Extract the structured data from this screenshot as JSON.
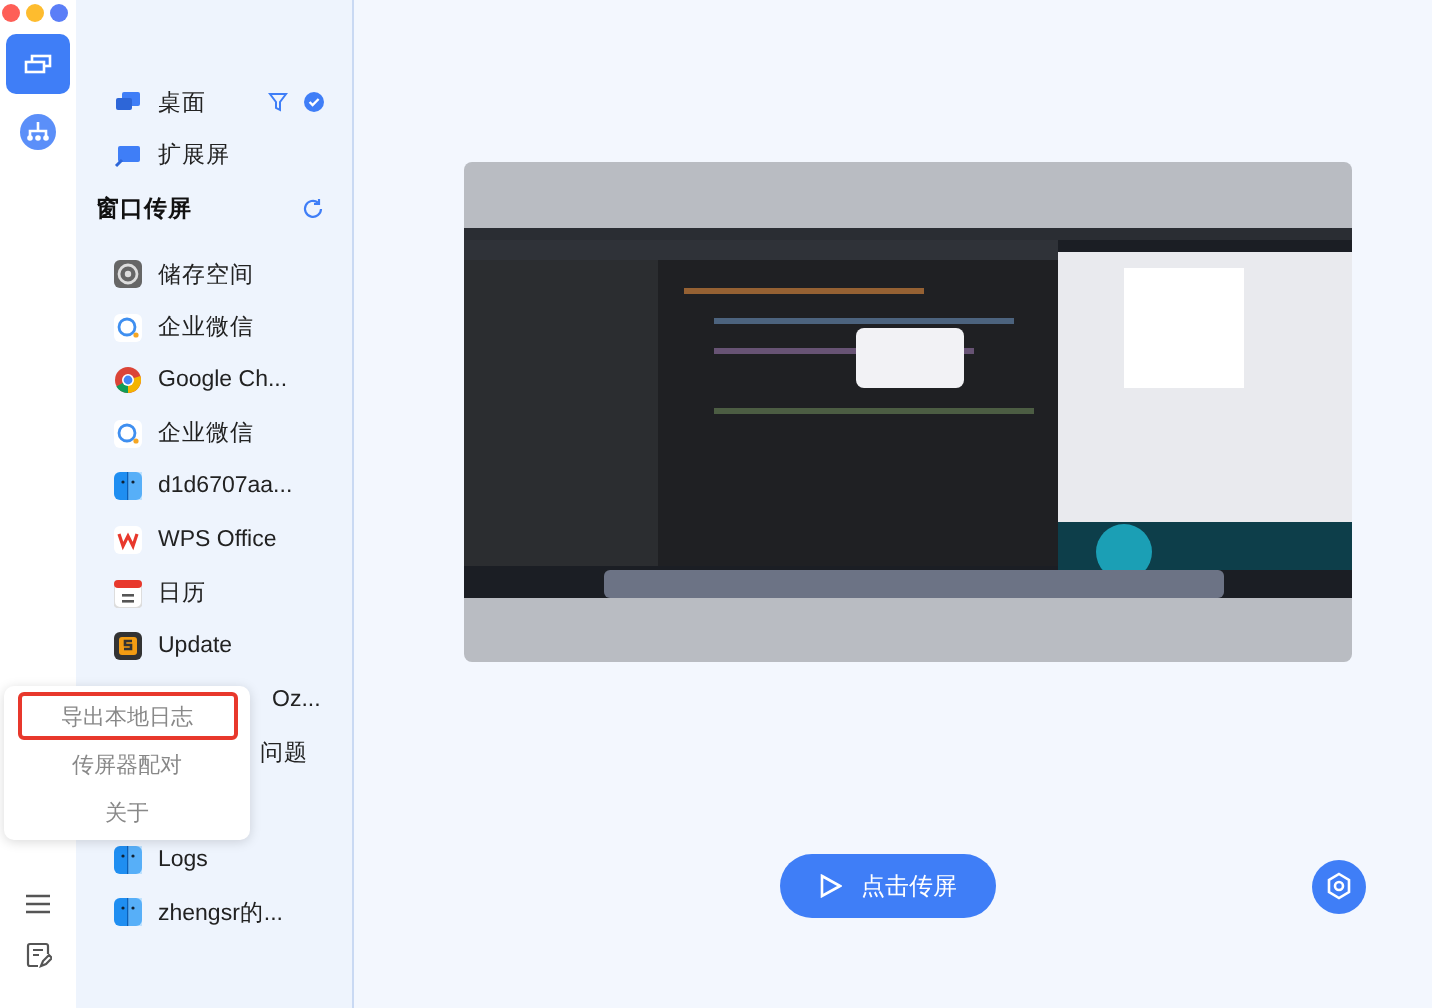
{
  "rail": {
    "items": [
      {
        "kind": "screens",
        "selected": true
      },
      {
        "kind": "network",
        "selected": false
      }
    ]
  },
  "sources": [
    {
      "kind": "desktop",
      "label": "桌面",
      "selected": true
    },
    {
      "kind": "extend",
      "label": "扩展屏",
      "selected": false
    }
  ],
  "window_section": {
    "title": "窗口传屏",
    "items": [
      {
        "kind": "gear",
        "label": "储存空间"
      },
      {
        "kind": "chat",
        "label": "企业微信"
      },
      {
        "kind": "chrome",
        "label": "Google Ch..."
      },
      {
        "kind": "chat",
        "label": "企业微信"
      },
      {
        "kind": "finder",
        "label": "d1d6707aa..."
      },
      {
        "kind": "wps",
        "label": "WPS Office"
      },
      {
        "kind": "calendar",
        "label": "日历"
      },
      {
        "kind": "update",
        "label": "Update"
      },
      {
        "kind": "partial",
        "label": "Oz..."
      },
      {
        "kind": "partial",
        "label": "问题"
      },
      {
        "kind": "covered"
      },
      {
        "kind": "finder",
        "label": "Logs"
      },
      {
        "kind": "finder",
        "label": "zhengsr的..."
      }
    ]
  },
  "menu": {
    "items": [
      {
        "label": "导出本地日志",
        "highlighted": true
      },
      {
        "label": "传屏器配对",
        "highlighted": false
      },
      {
        "label": "关于",
        "highlighted": false
      }
    ]
  },
  "cast_button": {
    "label": "点击传屏"
  }
}
